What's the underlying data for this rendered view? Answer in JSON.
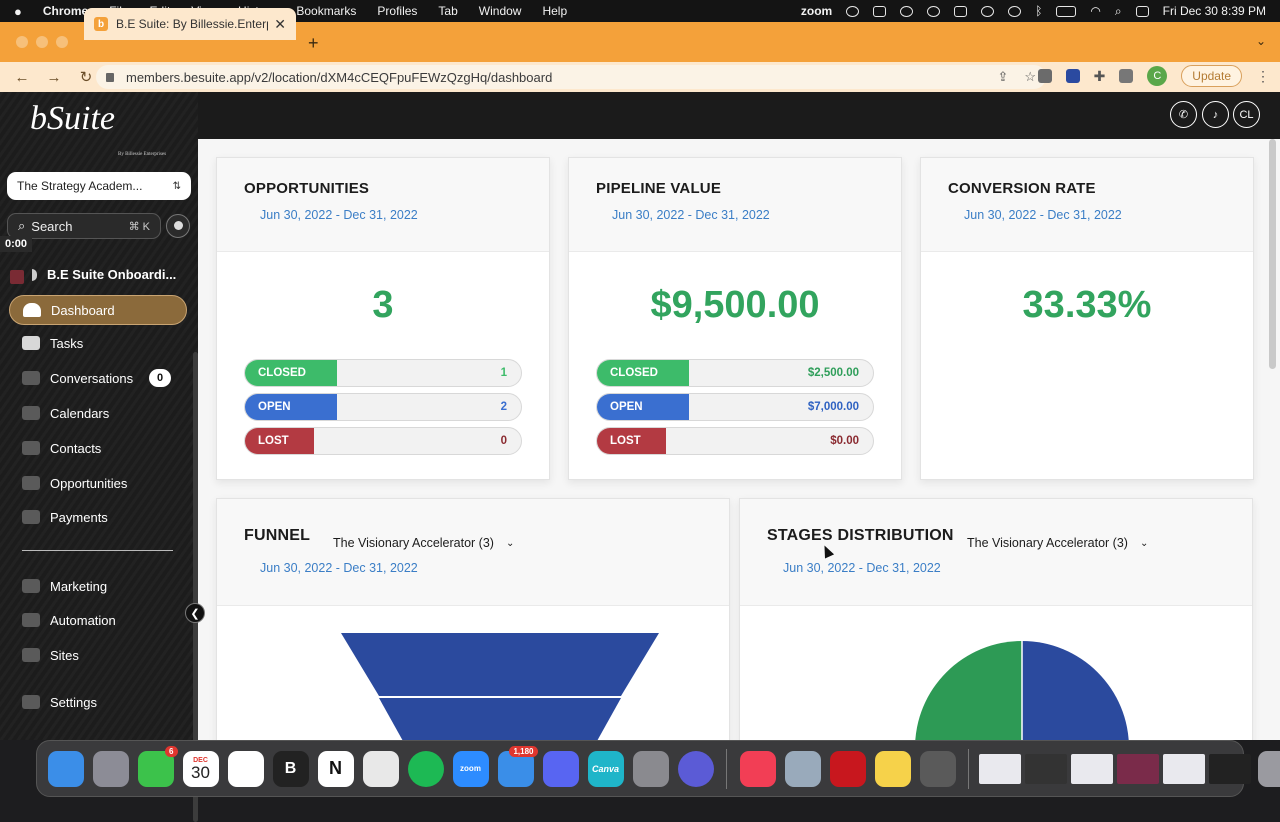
{
  "menubar": {
    "apple": "",
    "app": "Chrome",
    "items": [
      "File",
      "Edit",
      "View",
      "History",
      "Bookmarks",
      "Profiles",
      "Tab",
      "Window",
      "Help"
    ],
    "zoom": "zoom",
    "datetime": "Fri Dec 30  8:39 PM"
  },
  "browser": {
    "tab_title": "B.E Suite: By Billessie.Enterpris",
    "tab_favicon": "b",
    "new_tab": "+",
    "url": "members.besuite.app/v2/location/dXM4cCEQFpuFEWzQzgHq/dashboard",
    "profile_initial": "C",
    "update_label": "Update"
  },
  "sidebar": {
    "logo": "bSuite",
    "logo_sub": "By Billessie Enterprises",
    "account": "The Strategy Academ...",
    "search_label": "Search",
    "search_shortcut": "⌘ K",
    "timer": "0:00",
    "onboarding": "B.E Suite Onboardi...",
    "items": [
      {
        "label": "Dashboard"
      },
      {
        "label": "Tasks"
      },
      {
        "label": "Conversations",
        "badge": "0"
      },
      {
        "label": "Calendars"
      },
      {
        "label": "Contacts"
      },
      {
        "label": "Opportunities"
      },
      {
        "label": "Payments"
      },
      {
        "label": "Marketing"
      },
      {
        "label": "Automation"
      },
      {
        "label": "Sites"
      },
      {
        "label": "Settings"
      }
    ]
  },
  "header": {
    "phone_icon": "phone-icon",
    "bell_icon": "bell-icon",
    "user_initials": "CL"
  },
  "cards": {
    "opportunities": {
      "title": "OPPORTUNITIES",
      "range": "Jun 30, 2022 - Dec 31, 2022",
      "total": "3",
      "closed_label": "CLOSED",
      "closed_value": "1",
      "closed_fraction": 0.333,
      "open_label": "OPEN",
      "open_value": "2",
      "open_fraction": 0.333,
      "lost_label": "LOST",
      "lost_value": "0",
      "lost_fraction": 0.25
    },
    "pipeline": {
      "title": "PIPELINE VALUE",
      "range": "Jun 30, 2022 - Dec 31, 2022",
      "total": "$9,500.00",
      "closed_label": "CLOSED",
      "closed_value": "$2,500.00",
      "open_label": "OPEN",
      "open_value": "$7,000.00",
      "lost_label": "LOST",
      "lost_value": "$0.00"
    },
    "conversion": {
      "title": "CONVERSION RATE",
      "range": "Jun 30, 2022 - Dec 31, 2022",
      "total": "33.33%"
    },
    "funnel": {
      "title": "FUNNEL",
      "pipeline": "The Visionary Accelerator (3)",
      "range": "Jun 30, 2022 - Dec 31, 2022"
    },
    "stages": {
      "title": "STAGES DISTRIBUTION",
      "pipeline": "The Visionary Accelerator (3)",
      "range": "Jun 30, 2022 - Dec 31, 2022"
    }
  },
  "colors": {
    "closed": "#3dbb6a",
    "open": "#3a6fd0",
    "lost": "#b33a42",
    "accent_green": "#32a45e",
    "date_blue": "#3b7ec6",
    "funnel_blue": "#2b4a9e",
    "pie_green": "#2d9a55"
  },
  "dock": {
    "messages_badge": "6",
    "calendar_month": "DEC",
    "calendar_day": "30",
    "mail_badge": "1,180"
  }
}
